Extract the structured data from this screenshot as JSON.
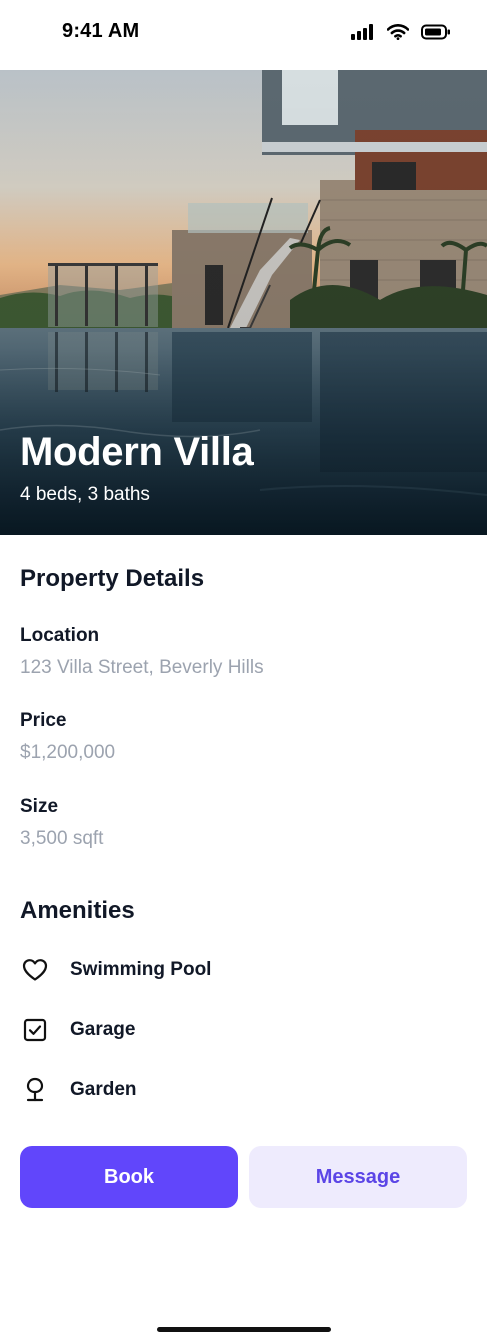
{
  "status_bar": {
    "time": "9:41 AM",
    "icons": [
      "signal-icon",
      "wifi-icon",
      "battery-icon"
    ]
  },
  "hero": {
    "title": "Modern Villa",
    "subtitle": "4 beds, 3 baths"
  },
  "property_details": {
    "heading": "Property Details",
    "items": [
      {
        "label": "Location",
        "value": "123 Villa Street, Beverly Hills"
      },
      {
        "label": "Price",
        "value": "$1,200,000"
      },
      {
        "label": "Size",
        "value": "3,500 sqft"
      }
    ]
  },
  "amenities": {
    "heading": "Amenities",
    "items": [
      {
        "label": "Swimming Pool",
        "icon": "heart-icon"
      },
      {
        "label": "Garage",
        "icon": "checkbox-icon"
      },
      {
        "label": "Garden",
        "icon": "tree-icon"
      }
    ]
  },
  "actions": {
    "book_label": "Book",
    "message_label": "Message"
  },
  "colors": {
    "accent": "#6146fb",
    "accent_light": "#eeebfd",
    "muted_text": "#9ca3af",
    "text": "#111827"
  }
}
